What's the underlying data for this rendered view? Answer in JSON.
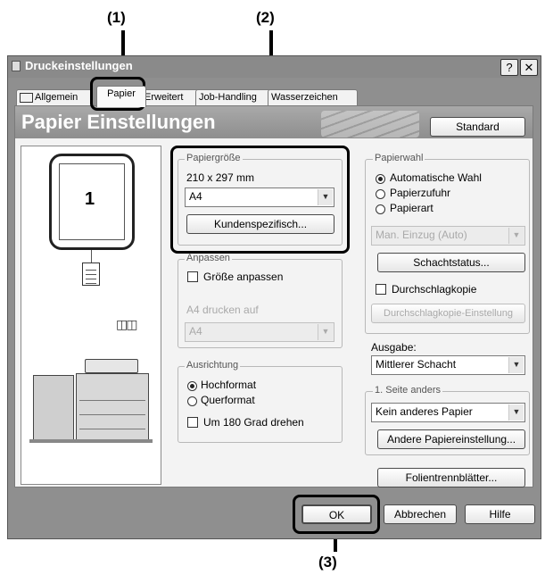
{
  "callouts": [
    "(1)",
    "(2)",
    "(3)"
  ],
  "window": {
    "title": "Druckeinstellungen",
    "help_button": "?",
    "close_button": "✕"
  },
  "tabs": [
    {
      "label": "Allgemein"
    },
    {
      "label": "Papier"
    },
    {
      "label": "Erweitert"
    },
    {
      "label": "Job-Handling"
    },
    {
      "label": "Wasserzeichen"
    }
  ],
  "banner": {
    "title": "Papier Einstellungen",
    "standard_button": "Standard"
  },
  "preview": {
    "page_number": "1"
  },
  "papiergroesse": {
    "group_label": "Papiergröße",
    "dimensions": "210 x 297 mm",
    "selected": "A4",
    "custom_button": "Kundenspezifisch..."
  },
  "anpassen": {
    "group_label": "Anpassen",
    "checkbox_label": "Größe anpassen",
    "print_on_label": "A4 drucken auf",
    "print_on_selected": "A4"
  },
  "ausrichtung": {
    "group_label": "Ausrichtung",
    "options": [
      "Hochformat",
      "Querformat"
    ],
    "selected": "Hochformat",
    "rotate_label": "Um 180 Grad drehen"
  },
  "papierwahl": {
    "group_label": "Papierwahl",
    "options": [
      "Automatische Wahl",
      "Papierzufuhr",
      "Papierart"
    ],
    "selected": "Automatische Wahl",
    "source_selected": "Man. Einzug (Auto)",
    "tray_status_button": "Schachtstatus...",
    "carbon_copy_label": "Durchschlagkopie",
    "carbon_copy_settings_button": "Durchschlagkopie-Einstellung"
  },
  "ausgabe": {
    "label": "Ausgabe:",
    "selected": "Mittlerer Schacht"
  },
  "erste_seite": {
    "group_label": "1. Seite anders",
    "selected": "Kein anderes Papier",
    "other_paper_button": "Andere Papiereinstellung..."
  },
  "folien_button": "Folientrennblätter...",
  "footer": {
    "ok": "OK",
    "cancel": "Abbrechen",
    "help": "Hilfe"
  }
}
